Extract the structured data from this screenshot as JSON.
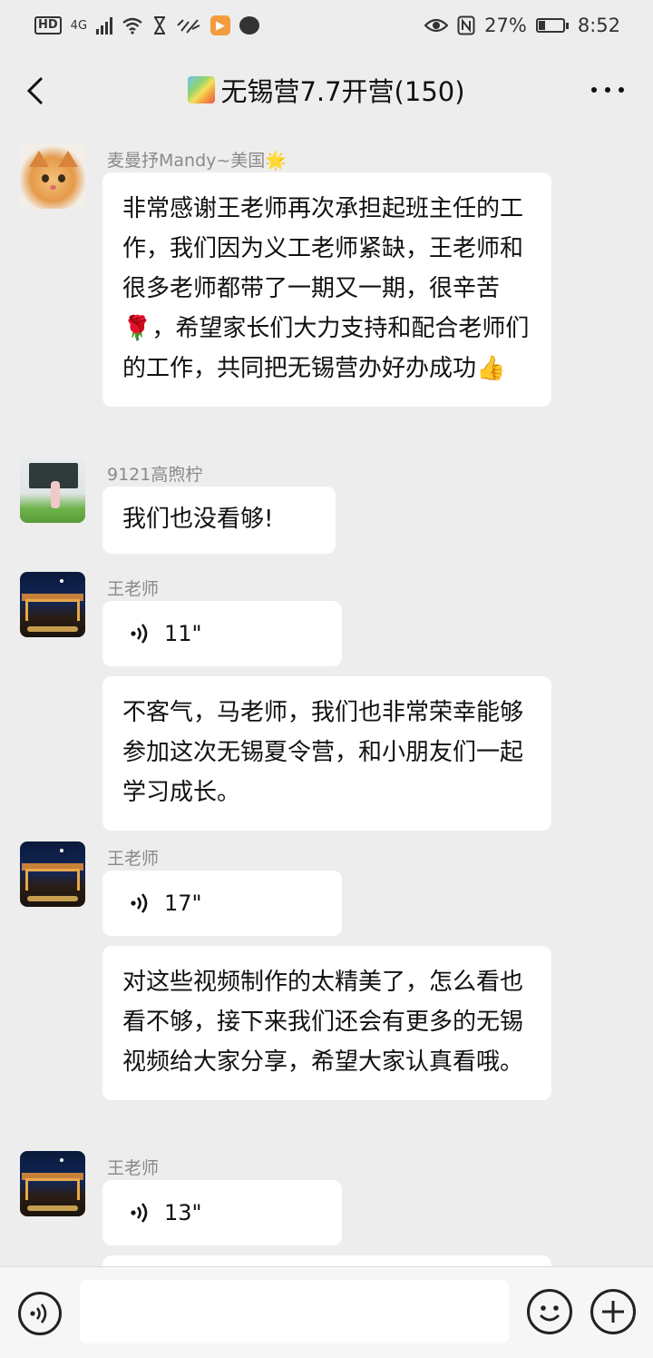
{
  "status_bar": {
    "hd": "HD",
    "network": "4G",
    "battery_percent": "27%",
    "battery_level": 0.27,
    "time": "8:52",
    "app_badge": "▶"
  },
  "nav": {
    "title": "无锡营7.7开营(150)"
  },
  "messages": [
    {
      "sender": "麦曼抒Mandy~美国🌟",
      "text": "非常感谢王老师再次承担起班主任的工作，我们因为义工老师紧缺，王老师和很多老师都带了一期又一期，很辛苦🌹，希望家长们大力支持和配合老师们的工作，共同把无锡营办好办成功👍"
    },
    {
      "sender": "9121高煦柠",
      "text": "我们也没看够!"
    },
    {
      "sender": "王老师",
      "voice_duration": "11\"",
      "text": "不客气，马老师，我们也非常荣幸能够参加这次无锡夏令营，和小朋友们一起学习成长。"
    },
    {
      "sender": "王老师",
      "voice_duration": "17\"",
      "text": "对这些视频制作的太精美了，怎么看也看不够，接下来我们还会有更多的无锡视频给大家分享，希望大家认真看哦。"
    },
    {
      "sender": "王老师",
      "voice_duration": "13\""
    }
  ],
  "colors": {
    "background": "#ededed",
    "bubble": "#ffffff",
    "sender_name": "#8a8a8a"
  }
}
